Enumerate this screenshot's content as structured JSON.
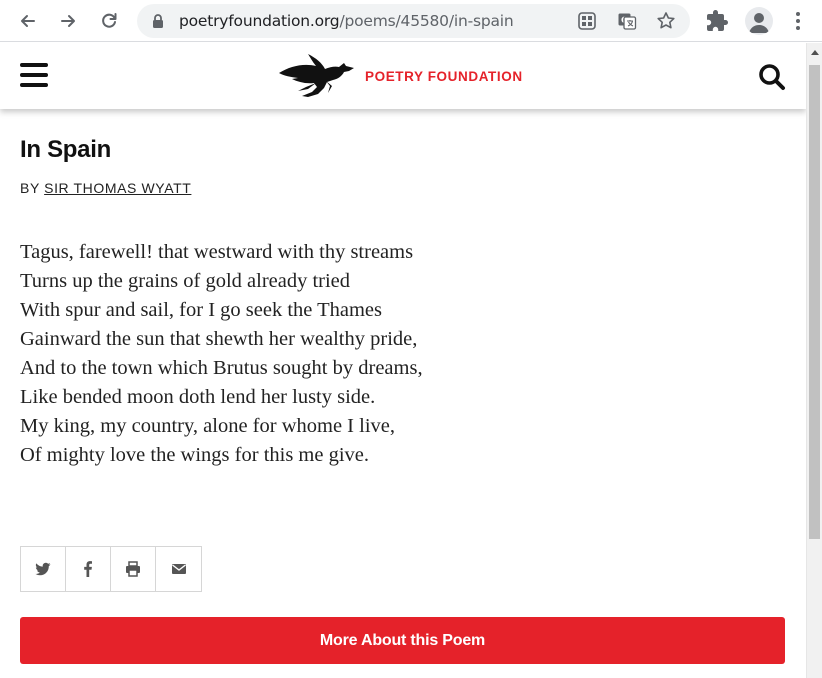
{
  "browser": {
    "url_host": "poetryfoundation.org",
    "url_path": "/poems/45580/in-spain"
  },
  "site": {
    "brand": "POETRY FOUNDATION",
    "brand_color": "#e5222a"
  },
  "poem": {
    "title": "In Spain",
    "by_label": "BY",
    "author": "SIR THOMAS WYATT",
    "lines": [
      "Tagus, farewell! that westward with thy streams",
      "Turns up the grains of gold already tried",
      "With spur and sail, for I go seek the Thames",
      "Gainward the sun that shewth her wealthy pride,",
      "And to the town which Brutus sought by dreams,",
      "Like bended moon doth lend her lusty side.",
      "My king, my country, alone for whome I live,",
      "Of mighty love the wings for this me give."
    ]
  },
  "share": {
    "icons": [
      "twitter-icon",
      "facebook-icon",
      "print-icon",
      "email-icon"
    ]
  },
  "actions": {
    "more_about": "More About this Poem"
  }
}
